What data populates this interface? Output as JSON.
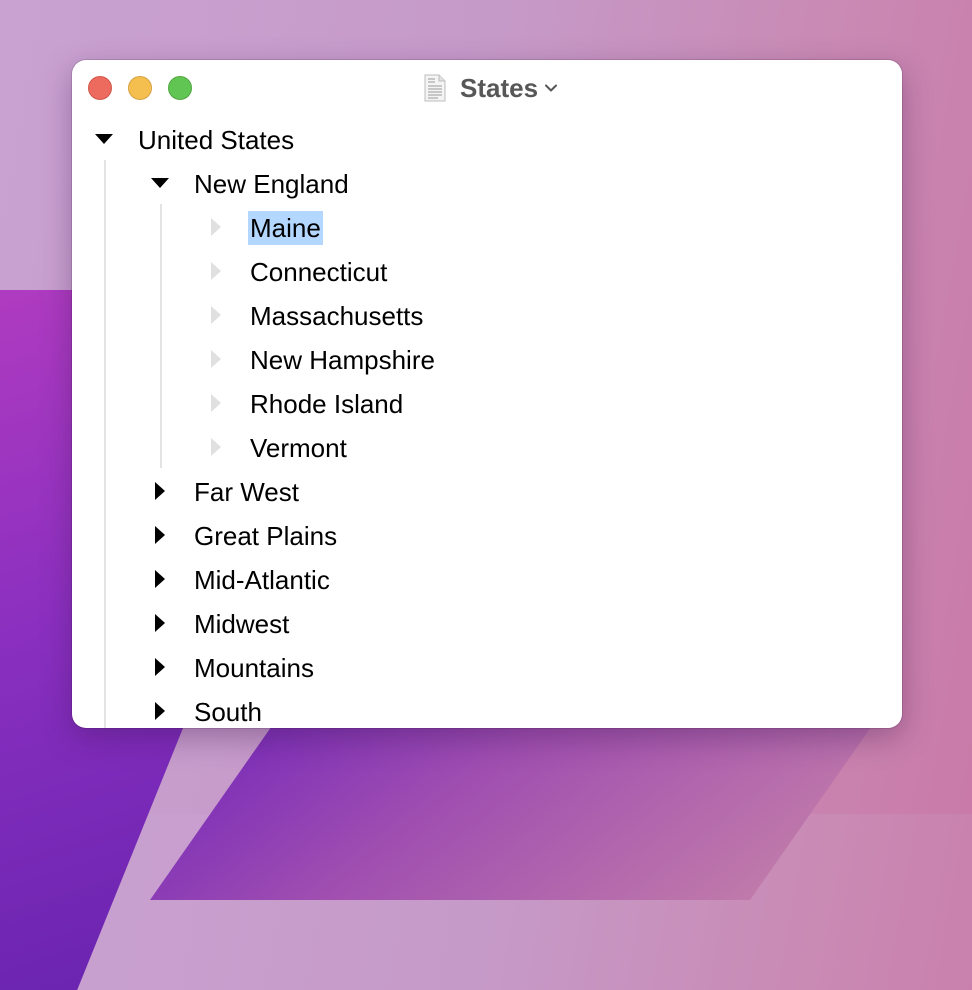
{
  "window": {
    "title": "States",
    "icon": "document-icon",
    "title_menu_icon": "chevron-down-icon"
  },
  "traffic_lights": [
    "close",
    "minimize",
    "zoom"
  ],
  "outline": {
    "root": {
      "label": "United States",
      "expanded": true
    },
    "group": {
      "label": "New England",
      "expanded": true
    },
    "states": [
      "Maine",
      "Connecticut",
      "Massachusetts",
      "New Hampshire",
      "Rhode Island",
      "Vermont"
    ],
    "selected": "Maine",
    "regions": [
      "Far West",
      "Great Plains",
      "Mid-Atlantic",
      "Midwest",
      "Mountains",
      "South"
    ]
  },
  "colors": {
    "selection": "#b3d7ff",
    "close": "#ec6a5e",
    "minimize": "#f4bf4f",
    "zoom": "#61c554"
  }
}
